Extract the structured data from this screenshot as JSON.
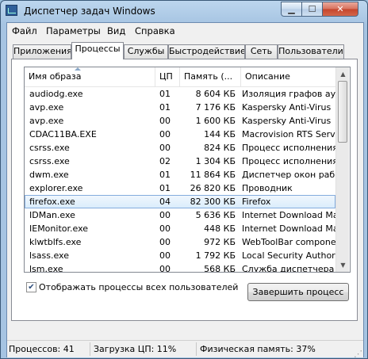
{
  "window": {
    "title": "Диспетчер задач Windows"
  },
  "menu": [
    "Файл",
    "Параметры",
    "Вид",
    "Справка"
  ],
  "tabs": [
    "Приложения",
    "Процессы",
    "Службы",
    "Быстродействие",
    "Сеть",
    "Пользователи"
  ],
  "active_tab": "Процессы",
  "columns": [
    "Имя образа",
    "ЦП",
    "Память (...",
    "Описание"
  ],
  "processes": [
    {
      "name": "audiodg.exe",
      "cpu": "01",
      "memory": "8 604 КБ",
      "description": "Изоляция графов аудиоус"
    },
    {
      "name": "avp.exe",
      "cpu": "01",
      "memory": "7 176 КБ",
      "description": "Kaspersky Anti-Virus"
    },
    {
      "name": "avp.exe",
      "cpu": "00",
      "memory": "1 600 КБ",
      "description": "Kaspersky Anti-Virus"
    },
    {
      "name": "CDAC11BA.EXE",
      "cpu": "00",
      "memory": "144 КБ",
      "description": "Macrovision RTS Service"
    },
    {
      "name": "csrss.exe",
      "cpu": "00",
      "memory": "824 КБ",
      "description": "Процесс исполнения клиен"
    },
    {
      "name": "csrss.exe",
      "cpu": "02",
      "memory": "1 304 КБ",
      "description": "Процесс исполнения клиен"
    },
    {
      "name": "dwm.exe",
      "cpu": "01",
      "memory": "11 864 КБ",
      "description": "Диспетчер окон рабочего"
    },
    {
      "name": "explorer.exe",
      "cpu": "01",
      "memory": "26 820 КБ",
      "description": "Проводник"
    },
    {
      "name": "firefox.exe",
      "cpu": "04",
      "memory": "82 300 КБ",
      "description": "Firefox"
    },
    {
      "name": "IDMan.exe",
      "cpu": "00",
      "memory": "5 636 КБ",
      "description": "Internet Download Manager"
    },
    {
      "name": "IEMonitor.exe",
      "cpu": "00",
      "memory": "448 КБ",
      "description": "Internet Download Manager"
    },
    {
      "name": "klwtblfs.exe",
      "cpu": "00",
      "memory": "972 КБ",
      "description": "WebToolBar component"
    },
    {
      "name": "lsass.exe",
      "cpu": "00",
      "memory": "1 792 КБ",
      "description": "Local Security Authority Pro"
    },
    {
      "name": "lsm.exe",
      "cpu": "00",
      "memory": "568 КБ",
      "description": "Служба диспетчера локал"
    }
  ],
  "selected_process": "firefox.exe",
  "show_all_users": {
    "label": "Отображать процессы всех пользователей",
    "checked": true
  },
  "end_process_label": "Завершить процесс",
  "status": {
    "processes": "Процессов: 41",
    "cpu": "Загрузка ЦП: 11%",
    "memory": "Физическая память: 37%"
  }
}
